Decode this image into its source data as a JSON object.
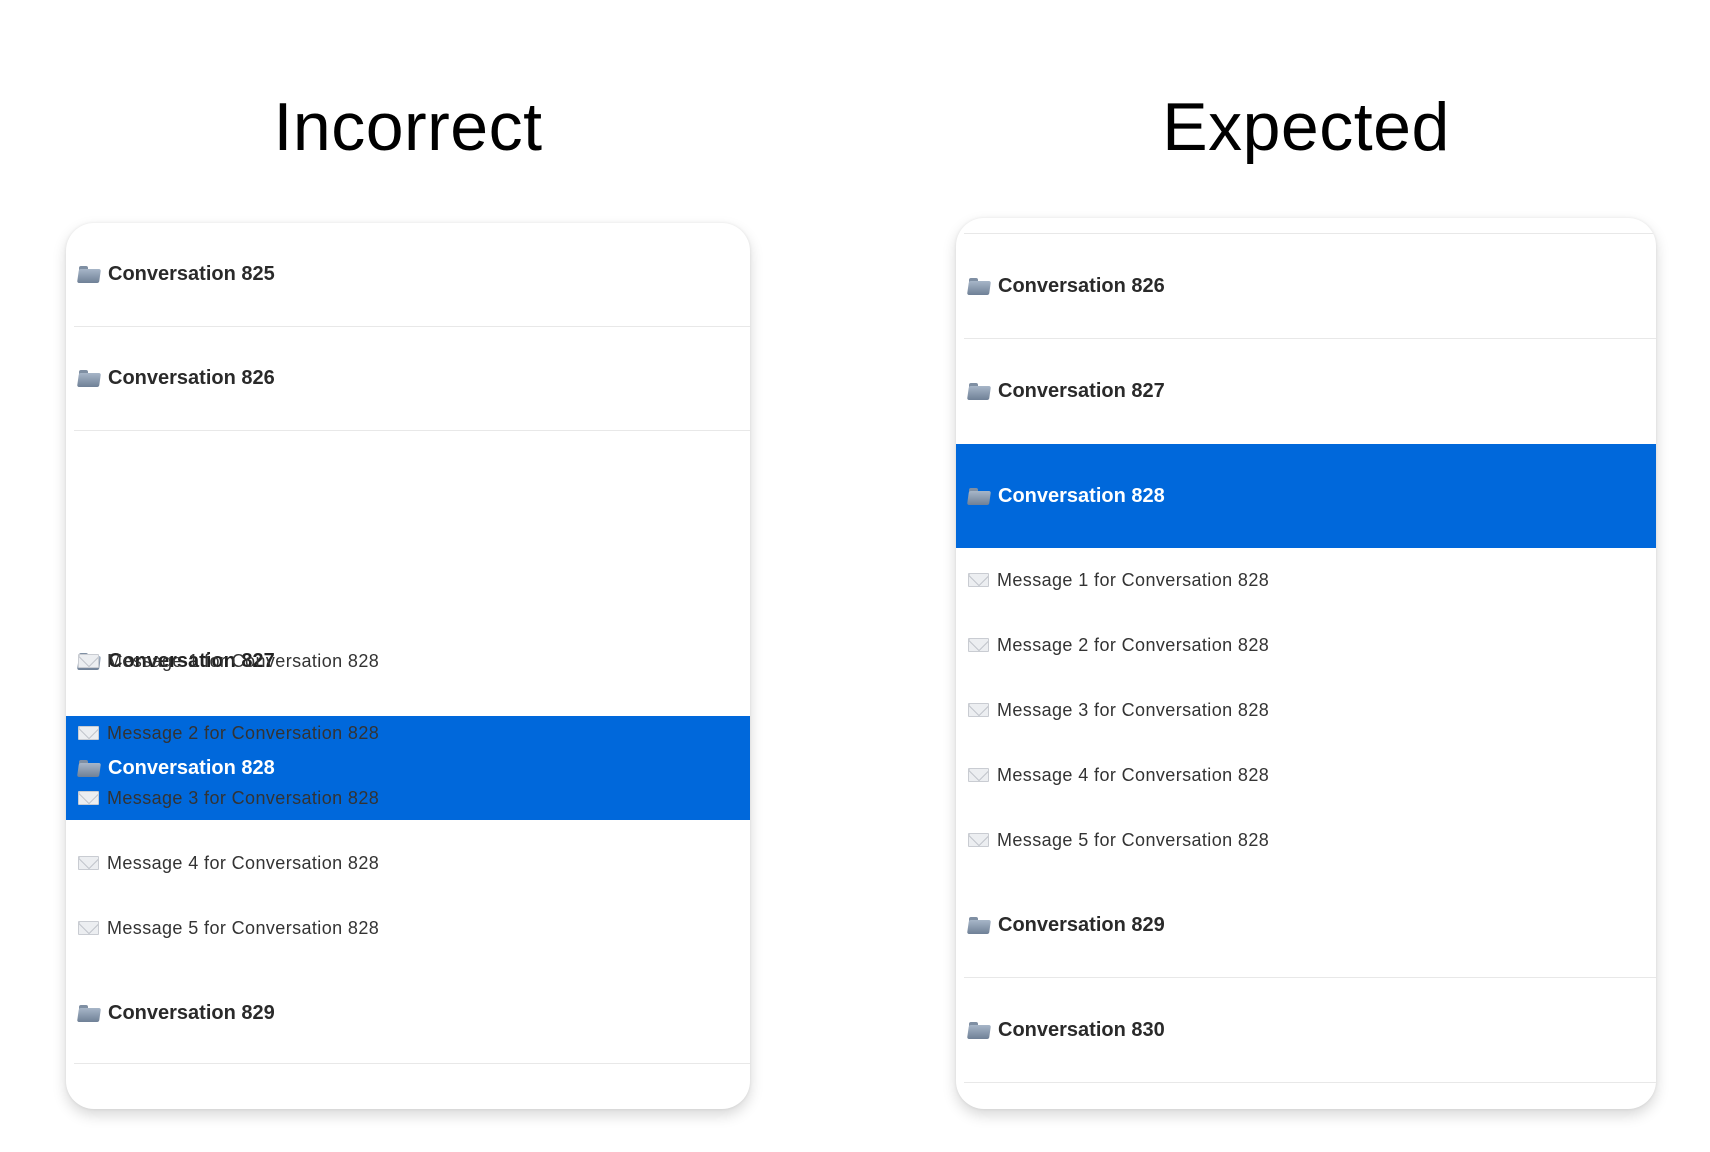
{
  "headings": {
    "left": "Incorrect",
    "right": "Expected"
  },
  "incorrect": {
    "conversations": {
      "c825": "Conversation 825",
      "c826": "Conversation 826",
      "c827": "Conversation 827",
      "c828": "Conversation 828",
      "c829": "Conversation 829"
    },
    "messages": {
      "m1": "Message 1 for Conversation 828",
      "m2": "Message 2 for Conversation 828",
      "m3": "Message 3 for Conversation 828",
      "m4": "Message 4 for Conversation 828",
      "m5": "Message 5 for Conversation 828"
    },
    "selected": "Conversation 828"
  },
  "expected": {
    "conversations": {
      "c826": "Conversation 826",
      "c827": "Conversation 827",
      "c828": "Conversation 828",
      "c829": "Conversation 829",
      "c830": "Conversation 830"
    },
    "messages": {
      "m1": "Message 1 for Conversation 828",
      "m2": "Message 2 for Conversation 828",
      "m3": "Message 3 for Conversation 828",
      "m4": "Message 4 for Conversation 828",
      "m5": "Message 5 for Conversation 828"
    },
    "selected": "Conversation 828"
  },
  "colors": {
    "selection": "#0068db",
    "background": "#ffffff",
    "divider": "#e8e8e8"
  },
  "icons": {
    "conversation": "folder-icon",
    "message": "mail-envelope-icon"
  }
}
